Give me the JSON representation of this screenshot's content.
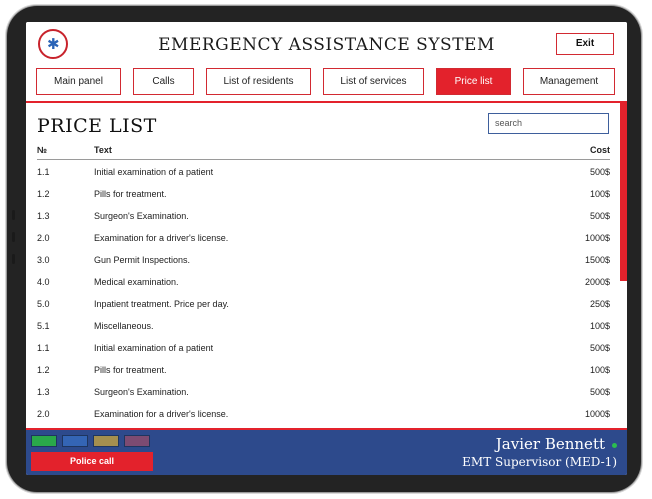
{
  "header": {
    "title": "EMERGENCY ASSISTANCE SYSTEM",
    "exit_label": "Exit",
    "logo_text": "EMERGENCY MEDICAL SERVICE",
    "nav": [
      {
        "label": "Main panel"
      },
      {
        "label": "Calls"
      },
      {
        "label": "List of residents"
      },
      {
        "label": "List of services"
      },
      {
        "label": "Price list"
      },
      {
        "label": "Management"
      }
    ],
    "active_tab": "Price list"
  },
  "page": {
    "title": "PRICE LIST",
    "search_placeholder": "search"
  },
  "table": {
    "columns": {
      "num": "№",
      "text": "Text",
      "cost": "Cost"
    },
    "rows": [
      {
        "num": "1.1",
        "text": "Initial examination of a patient",
        "cost": "500$"
      },
      {
        "num": "1.2",
        "text": "Pills for treatment.",
        "cost": "100$"
      },
      {
        "num": "1.3",
        "text": "Surgeon's Examination.",
        "cost": "500$"
      },
      {
        "num": "2.0",
        "text": "Examination for a driver's license.",
        "cost": "1000$"
      },
      {
        "num": "3.0",
        "text": "Gun Permit Inspections.",
        "cost": "1500$"
      },
      {
        "num": "4.0",
        "text": "Medical examination.",
        "cost": "2000$"
      },
      {
        "num": "5.0",
        "text": "Inpatient treatment. Price per day.",
        "cost": "250$"
      },
      {
        "num": "5.1",
        "text": "Miscellaneous.",
        "cost": "100$"
      },
      {
        "num": "1.1",
        "text": "Initial examination of a patient",
        "cost": "500$"
      },
      {
        "num": "1.2",
        "text": "Pills for treatment.",
        "cost": "100$"
      },
      {
        "num": "1.3",
        "text": "Surgeon's Examination.",
        "cost": "500$"
      },
      {
        "num": "2.0",
        "text": "Examination for a driver's license.",
        "cost": "1000$"
      }
    ]
  },
  "footer": {
    "swatches": [
      "#2aa84a",
      "#3465b5",
      "#a48f4f",
      "#7d4b72"
    ],
    "police_label": "Police call",
    "user_name": "Javier Bennett",
    "user_role": "EMT Supervisor (MED-1)",
    "status_color": "#2bbd4f"
  },
  "colors": {
    "accent": "#e3222c",
    "footer_bg": "#2d4a8c"
  }
}
